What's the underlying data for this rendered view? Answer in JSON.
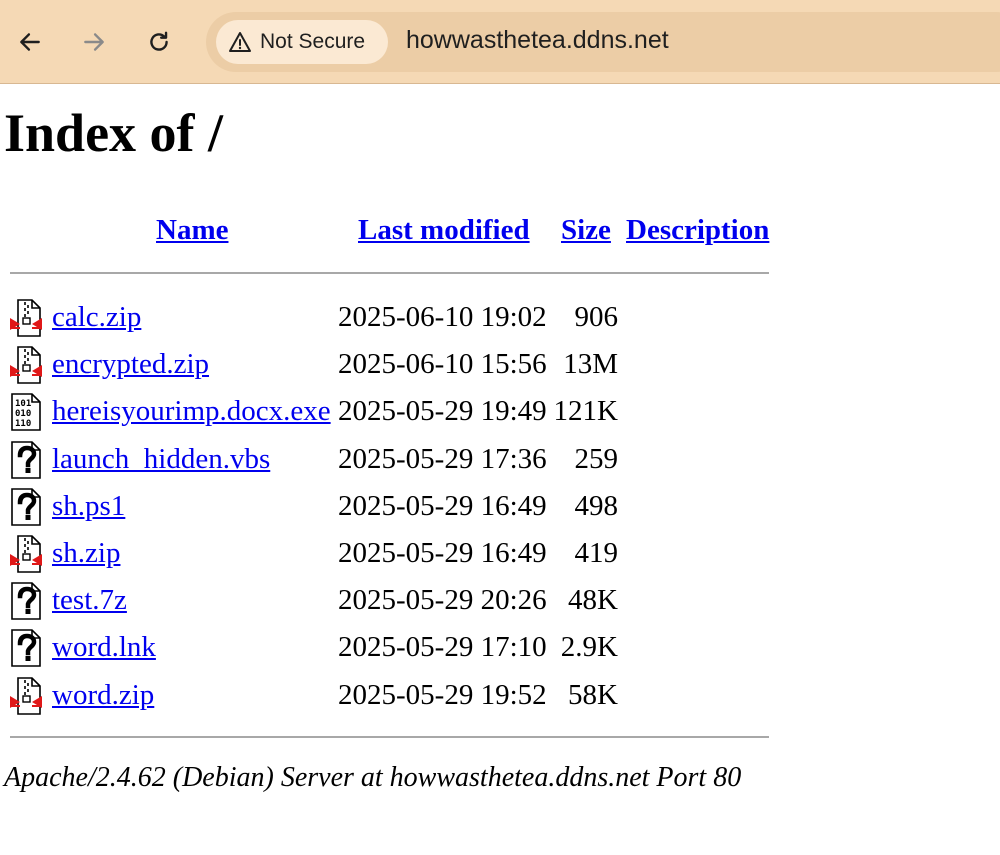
{
  "browser": {
    "security_label": "Not Secure",
    "url": "howwasthetea.ddns.net"
  },
  "page": {
    "title": "Index of /",
    "columns": {
      "name": "Name",
      "last_modified": "Last modified",
      "size": "Size",
      "description": "Description"
    },
    "files": [
      {
        "name": "calc.zip",
        "modified": "2025-06-10 19:02",
        "size": "906",
        "icon": "compressed-file-icon"
      },
      {
        "name": "encrypted.zip",
        "modified": "2025-06-10 15:56",
        "size": "13M",
        "icon": "compressed-file-icon"
      },
      {
        "name": "hereisyourimp.docx.exe",
        "modified": "2025-05-29 19:49",
        "size": "121K",
        "icon": "binary-file-icon"
      },
      {
        "name": "launch_hidden.vbs",
        "modified": "2025-05-29 17:36",
        "size": "259",
        "icon": "unknown-file-icon"
      },
      {
        "name": "sh.ps1",
        "modified": "2025-05-29 16:49",
        "size": "498",
        "icon": "unknown-file-icon"
      },
      {
        "name": "sh.zip",
        "modified": "2025-05-29 16:49",
        "size": "419",
        "icon": "compressed-file-icon"
      },
      {
        "name": "test.7z",
        "modified": "2025-05-29 20:26",
        "size": "48K",
        "icon": "unknown-file-icon"
      },
      {
        "name": "word.lnk",
        "modified": "2025-05-29 17:10",
        "size": "2.9K",
        "icon": "unknown-file-icon"
      },
      {
        "name": "word.zip",
        "modified": "2025-05-29 19:52",
        "size": "58K",
        "icon": "compressed-file-icon"
      }
    ],
    "footer": "Apache/2.4.62 (Debian) Server at howwasthetea.ddns.net Port 80"
  },
  "colors": {
    "toolbar_bg": "#f5d9b5",
    "link": "#0000ee"
  }
}
